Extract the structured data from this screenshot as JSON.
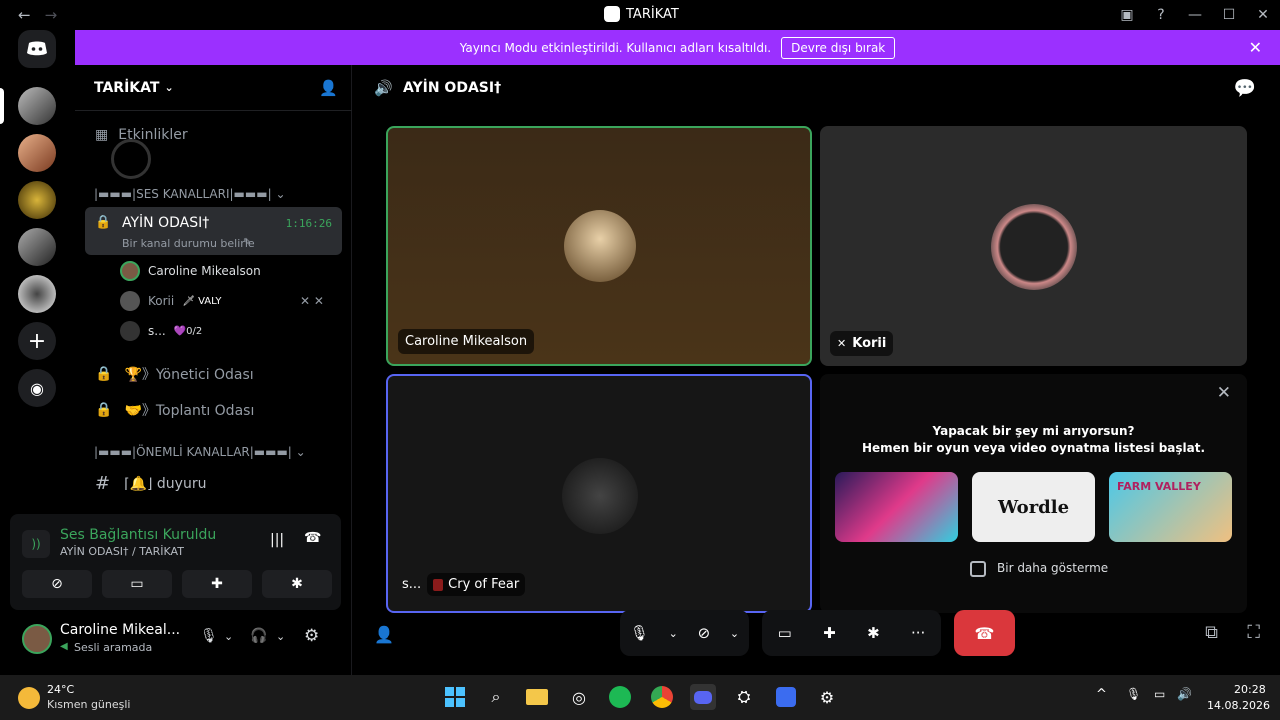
{
  "window": {
    "title": "TARİKAT"
  },
  "banner": {
    "text": "Yayıncı Modu etkinleştirildi. Kullanıcı adları kısaltıldı.",
    "button": "Devre dışı bırak"
  },
  "guild": {
    "name": "TARİKAT"
  },
  "sidebar": {
    "events": "Etkinlikler",
    "cat_voice": "|▬▬▬|SES KANALLARI|▬▬▬|",
    "active_channel": {
      "name": "AYİN ODASI†",
      "timer": "1:16:26",
      "status": "Bir kanal durumu belirle"
    },
    "voice_users": [
      {
        "name": "Caroline Mikealson",
        "tag": ""
      },
      {
        "name": "Korii",
        "tag": "🗡 VALY"
      },
      {
        "name": "s...",
        "tag": "💜0/2"
      }
    ],
    "channels": [
      {
        "name": "🏆》Yönetici Odası"
      },
      {
        "name": "🤝》Toplantı Odası"
      }
    ],
    "cat_important": "|▬▬▬|ÖNEMLİ KANALLAR|▬▬▬|",
    "text_channel": "⌈🔔⌋ duyuru"
  },
  "voice_panel": {
    "status": "Ses Bağlantısı Kuruldu",
    "location": "AYİN ODASI† / TARİKAT"
  },
  "user": {
    "name": "Caroline Mikeal...",
    "status": "Sesli aramada"
  },
  "main": {
    "channel_title": "AYİN ODASI†",
    "tiles": [
      {
        "name": "Caroline Mikealson"
      },
      {
        "name": "Korii"
      },
      {
        "name": "s...",
        "activity": "Cry of Fear"
      }
    ],
    "activity_card": {
      "line1": "Yapacak bir şey mi arıyorsun?",
      "line2": "Hemen bir oyun veya video oynatma listesi başlat.",
      "checkbox": "Bir daha gösterme",
      "games": [
        "",
        "Wordle",
        "FARM VALLEY"
      ]
    }
  },
  "taskbar": {
    "temp": "24°C",
    "weather": "Kısmen güneşli",
    "time": "20:28",
    "date": "14.08.2026"
  }
}
